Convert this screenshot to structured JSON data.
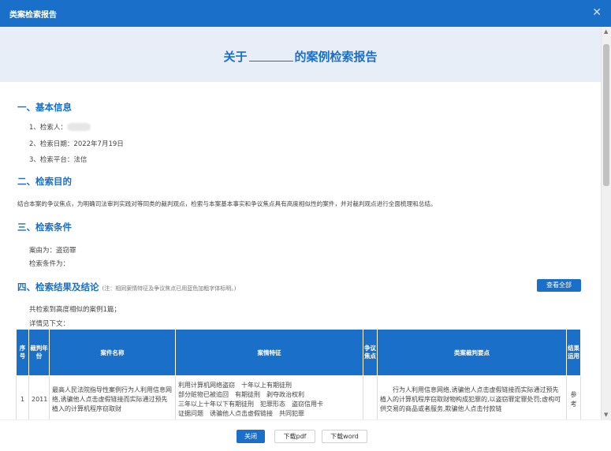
{
  "dialog": {
    "title": "类案检索报告"
  },
  "hero": {
    "prefix": "关于",
    "suffix": "的案例检索报告"
  },
  "sections": {
    "basic": {
      "heading": "一、基本信息",
      "searcher_label": "1、检索人：",
      "date": "2、检索日期：2022年7月19日",
      "platform": "3、检索平台：法信"
    },
    "purpose": {
      "heading": "二、检索目的",
      "text": "结合本案的争议焦点，为明确司法审判实践对等同类的裁判观点，检索与本案基本事实和争议焦点具有高度相似性的案件，并对裁判观点进行全面梳理和总结。"
    },
    "conditions": {
      "heading": "三、检索条件",
      "cause": "案由为：盗窃罪",
      "conds": "检索条件为："
    },
    "results": {
      "heading": "四、检索结果及结论",
      "note": "(注：相同案情特征及争议焦点已用蓝色加粗字体标明。)",
      "view_all": "查看全部",
      "summary": "共检索到高度相似的案例1篇；",
      "detail": "详情见下文："
    }
  },
  "table": {
    "headers": [
      "序号",
      "裁判年份",
      "案件名称",
      "案情特征",
      "争议焦点",
      "类案裁判要点",
      "结果运用"
    ],
    "rows": [
      {
        "no": "1",
        "year": "2011",
        "name": "最高人民法院指导性案例行为人利用信息网络,诱骗他人点击虚假链接而实际通过预先植入的计算机程序窃取财",
        "features": "利用计算机网络盗窃　十年以上有期徒刑\n部分赃物已被追回　有期徒刑　剥夺政治权利\n三年以上十年以下有期徒刑　犯罪形态　盗窃信用卡\n证据问题　诱骗他人点击虚假链接　共同犯罪",
        "focus": "",
        "points": "行为人利用信息网络,诱骗他人点击虚假链接而实际通过预先植入的计算机程序窃取财物构成犯罪的,以盗窃罪定罪处罚;虚构可供交易的商品或者服务,欺骗他人点击付款链",
        "usage": "参考"
      }
    ]
  },
  "footer": {
    "close": "关闭",
    "pdf": "下载pdf",
    "word": "下载word"
  }
}
